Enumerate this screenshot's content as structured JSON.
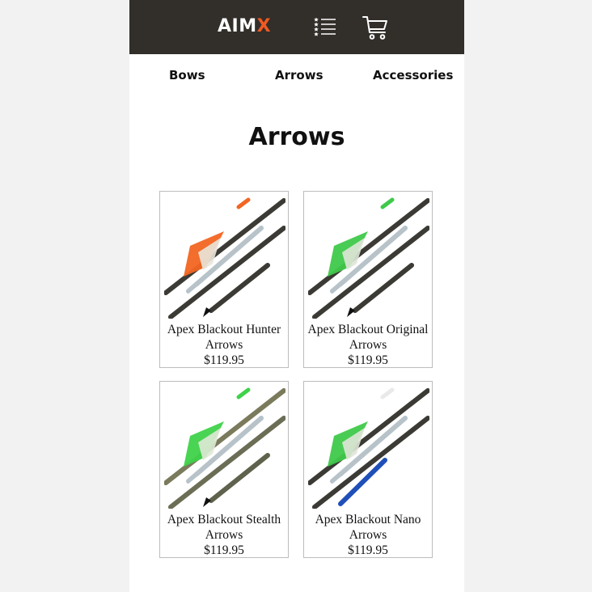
{
  "header": {
    "logo_main": "AIM",
    "logo_accent": "X",
    "menu_icon": "list-icon",
    "cart_icon": "shopping-cart-icon",
    "background_color": "#322f2a",
    "accent_color": "#f15a22"
  },
  "categories": [
    {
      "label": "Bows"
    },
    {
      "label": "Arrows"
    },
    {
      "label": "Accessories"
    }
  ],
  "page_title": "Arrows",
  "products": [
    {
      "name": "Apex Blackout Hunter Arrows",
      "price": "$119.95",
      "fletch_color": "#f26522",
      "image": "arrows-orange-fletching"
    },
    {
      "name": "Apex Blackout Original Arrows",
      "price": "$119.95",
      "fletch_color": "#3fc94a",
      "image": "arrows-green-fletching"
    },
    {
      "name": "Apex Blackout Stealth Arrows",
      "price": "$119.95",
      "fletch_color": "#3fd24a",
      "image": "camo-arrows-green-fletching"
    },
    {
      "name": "Apex Blackout Nano Arrows",
      "price": "$119.95",
      "fletch_color": "#3fc94a",
      "image": "arrows-green-fletching-blue-nock"
    }
  ]
}
